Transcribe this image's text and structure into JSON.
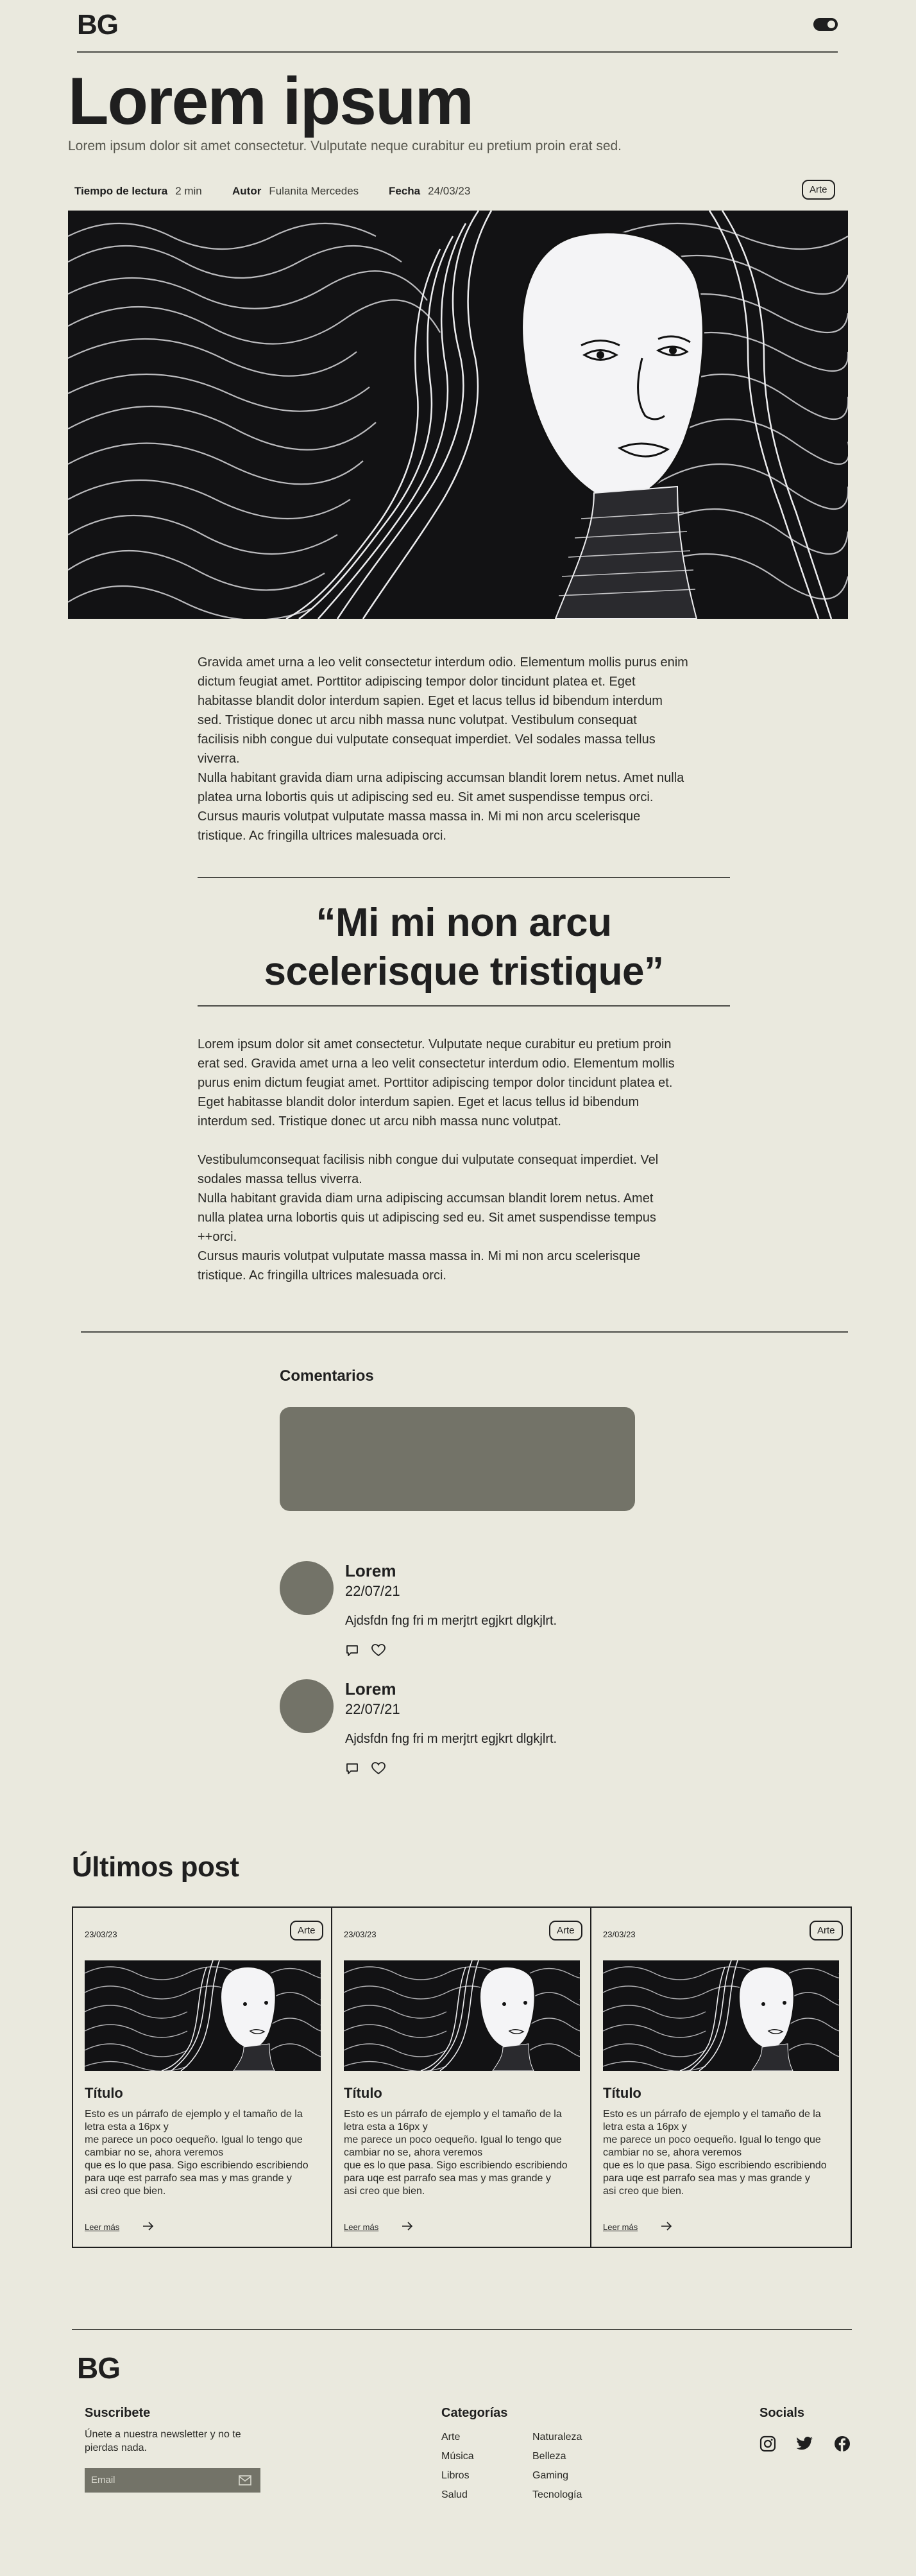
{
  "header": {
    "logo": "BG",
    "toggle_icon": "toggle-icon"
  },
  "hero": {
    "title": "Lorem ipsum",
    "subtitle": "Lorem ipsum dolor sit amet consectetur. Vulputate neque curabitur eu pretium proin erat sed."
  },
  "meta": {
    "reading_label": "Tiempo de lectura",
    "reading_value": "2 min",
    "author_label": "Autor",
    "author_value": "Fulanita Mercedes",
    "date_label": "Fecha",
    "date_value": "24/03/23",
    "tag": "Arte"
  },
  "article": {
    "p1": "Gravida amet urna a leo velit consectetur interdum odio. Elementum mollis purus enim\ndictum feugiat amet. Porttitor adipiscing tempor dolor tincidunt platea et. Eget\nhabitasse blandit dolor interdum sapien. Eget et lacus tellus id bibendum interdum\n sed. Tristique donec ut arcu nibh massa nunc volutpat. Vestibulum consequat\n facilisis nibh congue dui vulputate consequat imperdiet. Vel sodales massa tellus\nviverra.\nNulla habitant gravida diam urna adipiscing accumsan blandit lorem netus. Amet nulla\nplatea urna lobortis quis ut adipiscing sed eu. Sit amet suspendisse tempus orci.\n Cursus mauris volutpat vulputate massa massa in. Mi mi non arcu scelerisque\ntristique. Ac fringilla ultrices malesuada orci.",
    "quote_line1": "“Mi mi non arcu",
    "quote_line2": "scelerisque tristique”",
    "p2": "Lorem ipsum dolor sit amet consectetur. Vulputate neque curabitur eu pretium proin\nerat sed. Gravida amet urna a leo velit consectetur interdum odio. Elementum mollis\npurus enim dictum feugiat amet. Porttitor adipiscing tempor dolor tincidunt platea et.\nEget habitasse blandit dolor interdum sapien. Eget et lacus tellus id bibendum\ninterdum sed. Tristique donec ut arcu nibh massa nunc volutpat.\n\nVestibulumconsequat facilisis nibh congue dui vulputate consequat imperdiet. Vel\nsodales massa tellus viverra.\nNulla habitant gravida diam urna adipiscing accumsan blandit lorem netus. Amet\nnulla platea urna lobortis quis ut adipiscing sed eu. Sit amet suspendisse tempus\n++orci.\nCursus mauris volutpat vulputate massa massa in. Mi mi non arcu scelerisque\ntristique. Ac fringilla ultrices malesuada orci."
  },
  "comments": {
    "title": "Comentarios",
    "items": [
      {
        "name": "Lorem",
        "date": "22/07/21",
        "text": "Ajdsfdn fng fri m merjtrt egjkrt dlgkjlrt."
      },
      {
        "name": "Lorem",
        "date": "22/07/21",
        "text": "Ajdsfdn fng fri m merjtrt egjkrt dlgkjlrt."
      }
    ]
  },
  "posts": {
    "title": "Últimos post",
    "items": [
      {
        "date": "23/03/23",
        "tag": "Arte",
        "title": "Título",
        "text": "Esto es un párrafo de ejemplo y el tamaño de la\nletra esta a 16px y\nme parece un poco oequeño. Igual lo tengo que\ncambiar no se, ahora veremos\nque es lo que pasa. Sigo escribiendo escribiendo\npara uqe est parrafo sea mas y mas grande y\nasi creo que bien.",
        "link": "Leer más"
      },
      {
        "date": "23/03/23",
        "tag": "Arte",
        "title": "Título",
        "text": "Esto es un párrafo de ejemplo y el tamaño de la\nletra esta a 16px y\nme parece un poco oequeño. Igual lo tengo que\ncambiar no se, ahora veremos\nque es lo que pasa. Sigo escribiendo escribiendo\npara uqe est parrafo sea mas y mas grande y\nasi creo que bien.",
        "link": "Leer más"
      },
      {
        "date": "23/03/23",
        "tag": "Arte",
        "title": "Título",
        "text": "Esto es un párrafo de ejemplo y el tamaño de la\nletra esta a 16px y\nme parece un poco oequeño. Igual lo tengo que\ncambiar no se, ahora veremos\nque es lo que pasa. Sigo escribiendo escribiendo\npara uqe est parrafo sea mas y mas grande y\nasi creo que bien.",
        "link": "Leer más"
      }
    ]
  },
  "footer": {
    "logo": "BG",
    "subscribe_title": "Suscribete",
    "subscribe_text": "Únete a nuestra newsletter y no te\npierdas nada.",
    "email_placeholder": "Email",
    "categories_title": "Categorías",
    "categories_col1": [
      "Arte",
      "Música",
      "Libros",
      "Salud"
    ],
    "categories_col2": [
      "Naturaleza",
      "Belleza",
      "Gaming",
      "Tecnología"
    ],
    "socials_title": "Socials",
    "social_icons": [
      "instagram-icon",
      "twitter-icon",
      "facebook-icon"
    ]
  },
  "colors": {
    "background": "#EAE9DE",
    "text": "#1F1F1F",
    "gray_block": "#737368",
    "art_background": "#121214"
  }
}
